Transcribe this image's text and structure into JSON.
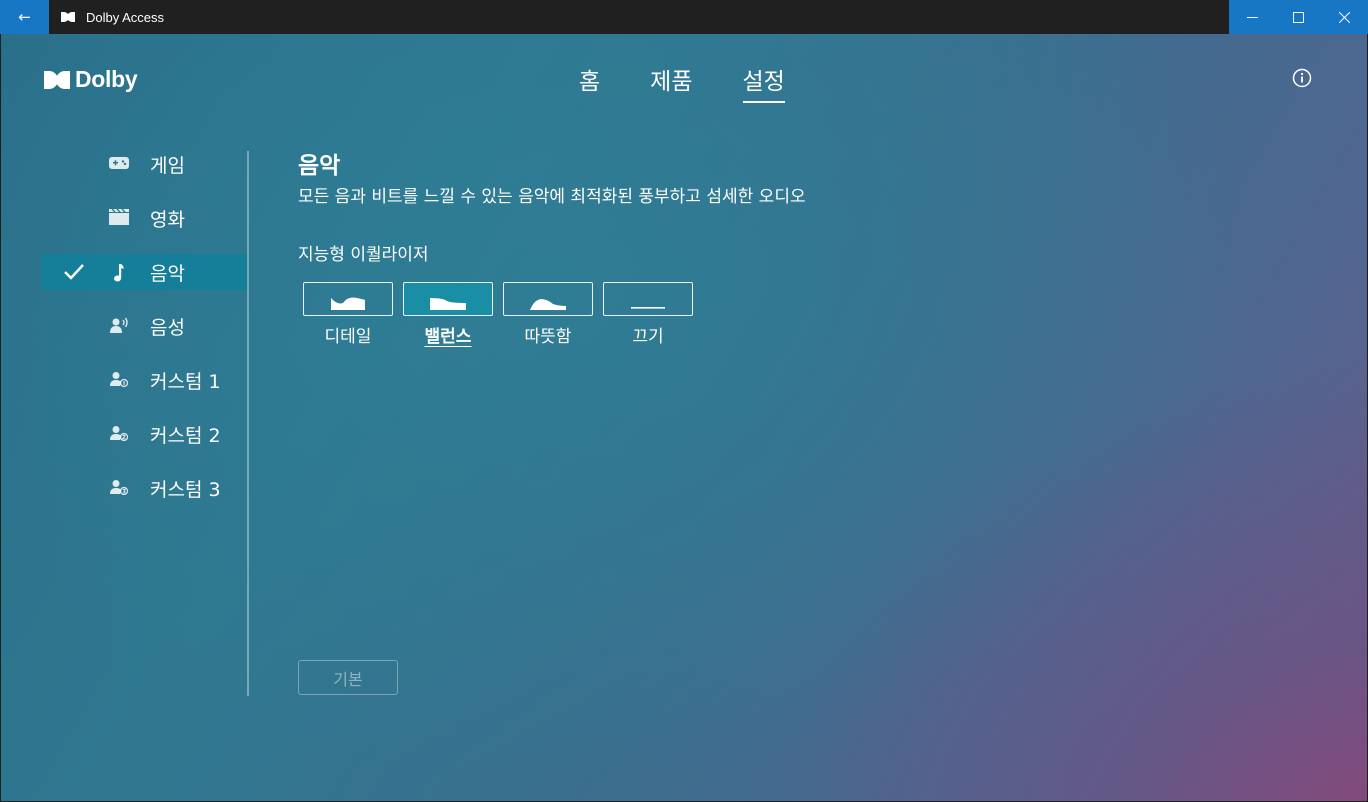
{
  "window": {
    "title": "Dolby Access",
    "back_glyph": "←",
    "controls": {
      "minimize": "—",
      "maximize": "☐",
      "close": "✕"
    }
  },
  "brand": {
    "name": "Dolby"
  },
  "nav": {
    "tabs": [
      {
        "label": "홈",
        "active": false
      },
      {
        "label": "제품",
        "active": false
      },
      {
        "label": "설정",
        "active": true
      }
    ],
    "info_icon": "info-icon"
  },
  "sidebar": {
    "items": [
      {
        "label": "게임",
        "icon": "gamepad-icon",
        "active": false
      },
      {
        "label": "영화",
        "icon": "clapperboard-icon",
        "active": false
      },
      {
        "label": "음악",
        "icon": "music-note-icon",
        "active": true
      },
      {
        "label": "음성",
        "icon": "voice-icon",
        "active": false
      },
      {
        "label": "커스텀 1",
        "icon": "custom-profile-1-icon",
        "active": false
      },
      {
        "label": "커스텀 2",
        "icon": "custom-profile-2-icon",
        "active": false
      },
      {
        "label": "커스텀 3",
        "icon": "custom-profile-3-icon",
        "active": false
      }
    ]
  },
  "content": {
    "title": "음악",
    "description": "모든 음과 비트를 느낄 수 있는 음악에 최적화된 풍부하고 섬세한 오디오",
    "equalizer": {
      "label": "지능형 이퀄라이저",
      "options": [
        {
          "label": "디테일",
          "selected": false
        },
        {
          "label": "밸런스",
          "selected": true
        },
        {
          "label": "따뜻함",
          "selected": false
        },
        {
          "label": "끄기",
          "selected": false
        }
      ]
    },
    "default_button": "기본"
  },
  "colors": {
    "titlebar": "#202020",
    "accent_blue": "#1877c4",
    "active_item": "#157e98",
    "selected_eq": "#1a8ea5"
  }
}
